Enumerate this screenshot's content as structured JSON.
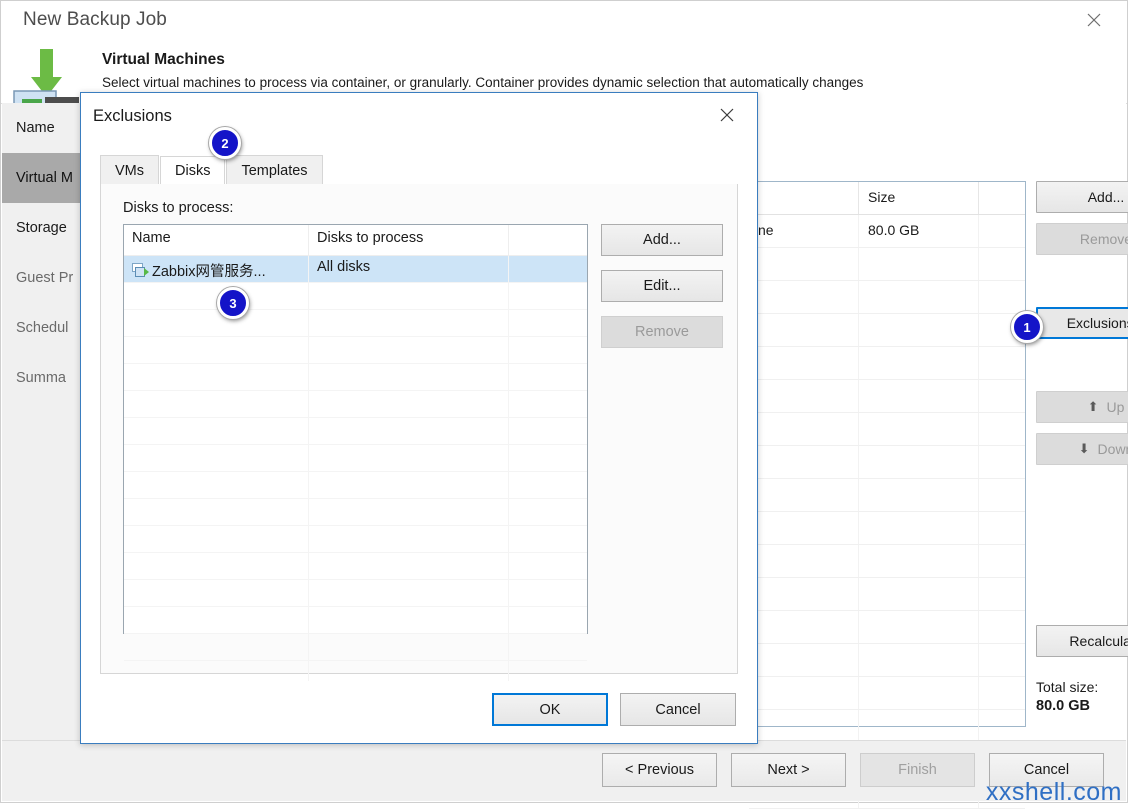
{
  "window": {
    "title": "New Backup Job",
    "close_icon": "close-icon",
    "page_heading": "Virtual Machines",
    "page_description": "Select virtual machines to process via container, or granularly. Container provides dynamic selection that automatically changes",
    "logo_icon": "vmware-download-icon"
  },
  "sidebar": {
    "items": [
      {
        "label": "Name",
        "state": "normal"
      },
      {
        "label": "Virtual M",
        "state": "active"
      },
      {
        "label": "Storage",
        "state": "normal"
      },
      {
        "label": "Guest Pr",
        "state": "dim"
      },
      {
        "label": "Schedul",
        "state": "dim"
      },
      {
        "label": "Summa",
        "state": "dim"
      }
    ]
  },
  "main_grid": {
    "headers": [
      "",
      "Size",
      ""
    ],
    "rows": [
      {
        "name": "ne",
        "size": "80.0 GB"
      },
      {
        "name": "",
        "size": ""
      },
      {
        "name": "",
        "size": ""
      },
      {
        "name": "",
        "size": ""
      },
      {
        "name": "",
        "size": ""
      },
      {
        "name": "",
        "size": ""
      },
      {
        "name": "",
        "size": ""
      },
      {
        "name": "",
        "size": ""
      },
      {
        "name": "",
        "size": ""
      },
      {
        "name": "",
        "size": ""
      },
      {
        "name": "",
        "size": ""
      },
      {
        "name": "",
        "size": ""
      },
      {
        "name": "",
        "size": ""
      },
      {
        "name": "",
        "size": ""
      },
      {
        "name": "",
        "size": ""
      },
      {
        "name": "",
        "size": ""
      },
      {
        "name": "",
        "size": ""
      },
      {
        "name": "",
        "size": ""
      }
    ]
  },
  "side_buttons": {
    "add": "Add...",
    "remove": "Remove",
    "exclusions": "Exclusions...",
    "up": "Up",
    "down": "Down",
    "up_icon": "arrow-up-icon",
    "down_icon": "arrow-down-icon",
    "recalculate": "Recalculate",
    "total_size_label": "Total size:",
    "total_size_value": "80.0 GB"
  },
  "nav": {
    "previous": "< Previous",
    "next": "Next >",
    "finish": "Finish",
    "cancel": "Cancel"
  },
  "modal": {
    "title": "Exclusions",
    "close_icon": "close-icon",
    "tabs": [
      {
        "label": "VMs",
        "active": false
      },
      {
        "label": "Disks",
        "active": true
      },
      {
        "label": "Templates",
        "active": false
      }
    ],
    "list_label": "Disks to process:",
    "list_headers": [
      "Name",
      "Disks to process",
      ""
    ],
    "rows": [
      {
        "name": "Zabbix网管服务...",
        "disks": "All disks",
        "icon": "vm-machine-icon",
        "selected": true
      }
    ],
    "empty_rows": 15,
    "buttons": {
      "add": "Add...",
      "edit": "Edit...",
      "remove": "Remove"
    },
    "footer": {
      "ok": "OK",
      "cancel": "Cancel"
    }
  },
  "callouts": [
    {
      "number": "1",
      "target": "exclusions-button"
    },
    {
      "number": "2",
      "target": "tab-disks"
    },
    {
      "number": "3",
      "target": "disk-row"
    }
  ],
  "watermark": "xxshell.com",
  "colors": {
    "accent": "#0078d7",
    "badge": "#1414c8",
    "selection": "#cde4f7",
    "watermark": "#2f6fc4"
  }
}
